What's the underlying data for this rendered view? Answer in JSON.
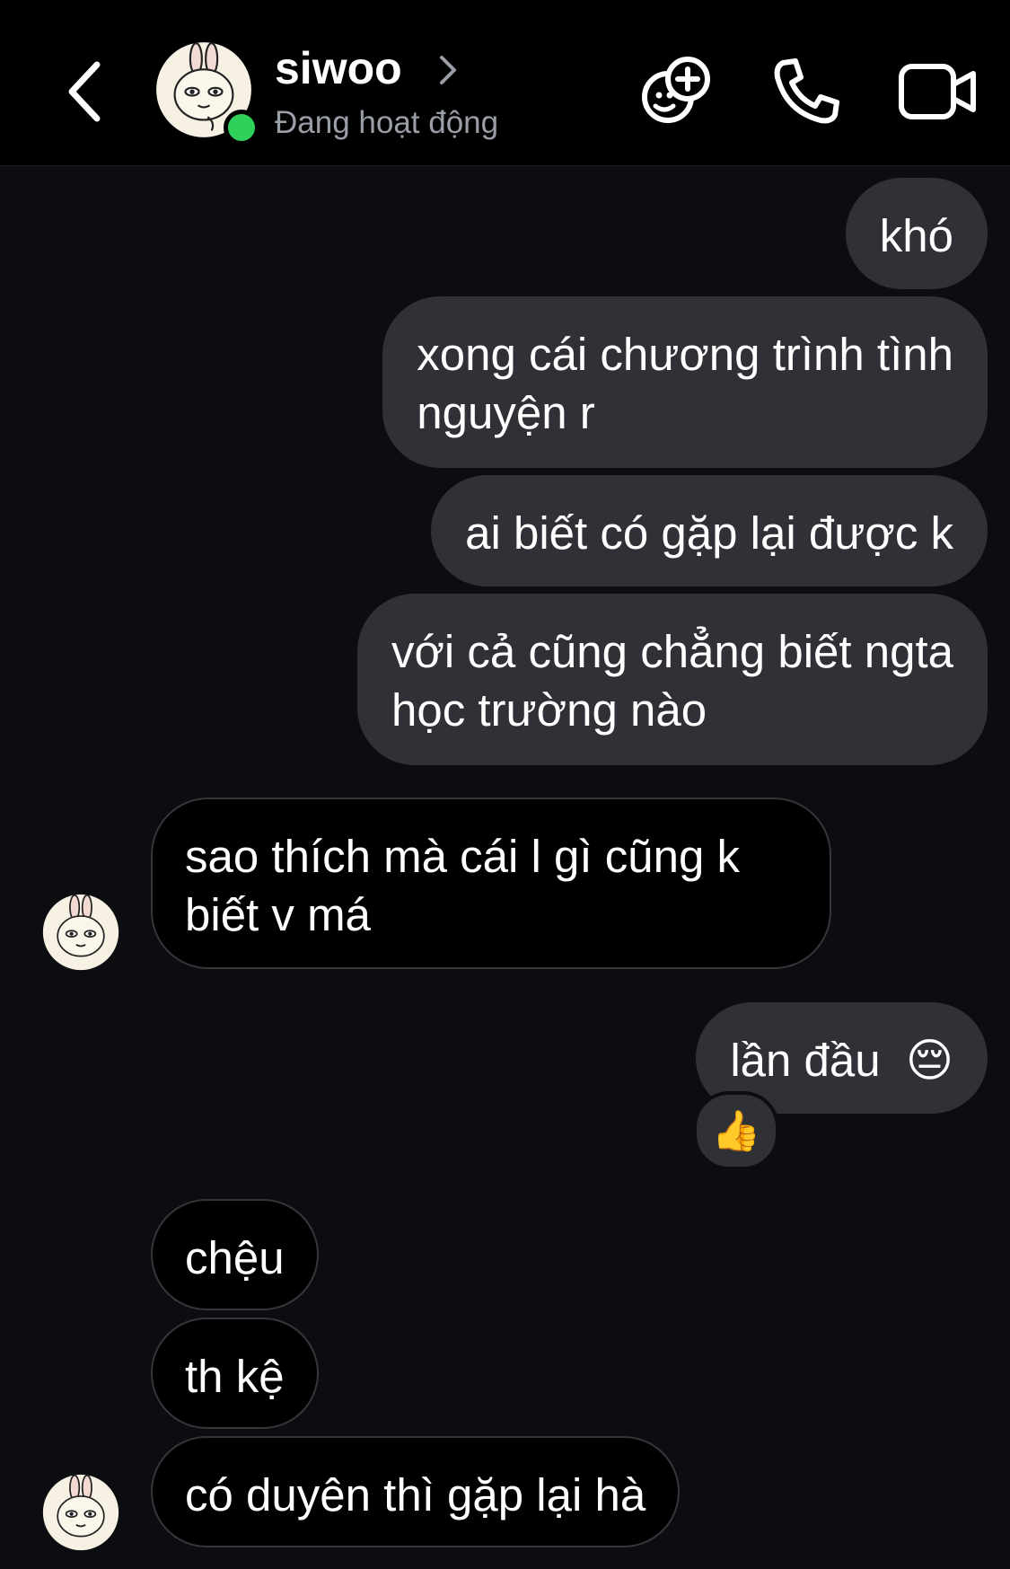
{
  "header": {
    "contact_name": "siwoo",
    "status": "Đang hoạt động",
    "icons": [
      "back-chevron-icon",
      "name-chevron-icon",
      "effects-icon",
      "phone-icon",
      "video-camera-icon"
    ]
  },
  "colors": {
    "background": "#0b0d10",
    "outgoing_bubble": "#2f3136",
    "incoming_bubble": "#000000",
    "online": "#2fd15b"
  },
  "messages": [
    {
      "side": "out",
      "text": "khó"
    },
    {
      "side": "out",
      "lines": [
        "xong cái chương trình tình",
        "nguyện r"
      ]
    },
    {
      "side": "out",
      "text": "ai biết có gặp lại được k"
    },
    {
      "side": "out",
      "lines": [
        "với cả cũng chẳng biết ngta",
        "học trường nào"
      ]
    },
    {
      "side": "in",
      "lines": [
        "sao thích mà cái l gì cũng k",
        "biết v má"
      ]
    },
    {
      "side": "out",
      "text": "lần đầu",
      "emoji": "😔",
      "reaction": "👍"
    },
    {
      "side": "in",
      "text": "chệu"
    },
    {
      "side": "in",
      "text": "th kệ"
    },
    {
      "side": "in",
      "text": "có duyên thì gặp lại hà"
    }
  ]
}
